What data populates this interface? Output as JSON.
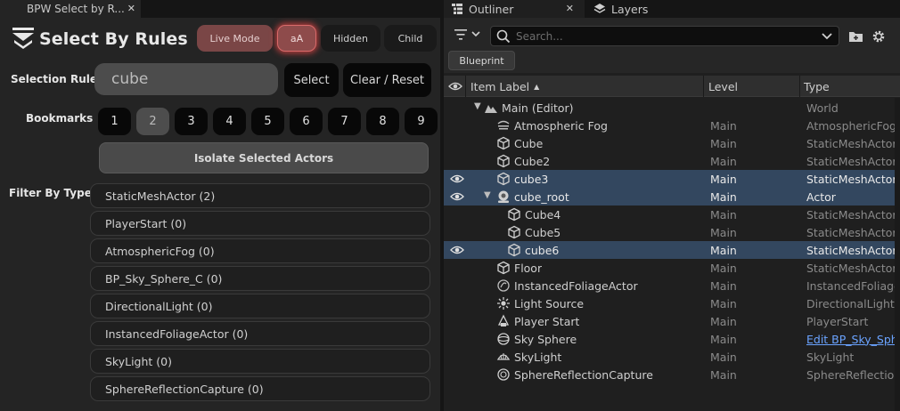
{
  "left_panel": {
    "tab_title": "BPW Select by R...",
    "title": "Select By Rules",
    "buttons": {
      "live_mode": "Live Mode",
      "match_case": "aA",
      "hidden": "Hidden",
      "child": "Child"
    },
    "selection_rule_label": "Selection Rule",
    "rule_input_value": "cube",
    "select_label": "Select",
    "clear_reset_label": "Clear / Reset",
    "bookmarks_label": "Bookmarks",
    "bookmarks": [
      "1",
      "2",
      "3",
      "4",
      "5",
      "6",
      "7",
      "8",
      "9"
    ],
    "selected_bookmark": "2",
    "isolate_label": "Isolate Selected Actors",
    "filter_label": "Filter By Types",
    "types": [
      "StaticMeshActor  (2)",
      "PlayerStart  (0)",
      "AtmosphericFog  (0)",
      "BP_Sky_Sphere_C  (0)",
      "DirectionalLight  (0)",
      "InstancedFoliageActor  (0)",
      "SkyLight  (0)",
      "SphereReflectionCapture  (0)"
    ]
  },
  "right_panel": {
    "tabs": [
      "Outliner",
      "Layers"
    ],
    "search_placeholder": "Search...",
    "blueprint_label": "Blueprint",
    "columns": [
      "Item Label",
      "Level",
      "Type"
    ],
    "rows": [
      {
        "label": "Main (Editor)",
        "level": "",
        "type": "World",
        "icon": "world-icon",
        "selected": false,
        "eye": false
      },
      {
        "label": "Atmospheric Fog",
        "level": "Main",
        "type": "AtmosphericFog",
        "icon": "fog-icon",
        "selected": false,
        "eye": false
      },
      {
        "label": "Cube",
        "level": "Main",
        "type": "StaticMeshActor",
        "icon": "mesh-icon",
        "selected": false,
        "eye": false
      },
      {
        "label": "Cube2",
        "level": "Main",
        "type": "StaticMeshActor",
        "icon": "mesh-icon",
        "selected": false,
        "eye": false
      },
      {
        "label": "cube3",
        "level": "Main",
        "type": "StaticMeshActor",
        "icon": "mesh-icon",
        "selected": true,
        "eye": true
      },
      {
        "label": "cube_root",
        "level": "Main",
        "type": "Actor",
        "icon": "actor-icon",
        "selected": true,
        "eye": true
      },
      {
        "label": "Cube4",
        "level": "Main",
        "type": "StaticMeshActor",
        "icon": "mesh-icon",
        "selected": false,
        "eye": false
      },
      {
        "label": "Cube5",
        "level": "Main",
        "type": "StaticMeshActor",
        "icon": "mesh-icon",
        "selected": false,
        "eye": false
      },
      {
        "label": "cube6",
        "level": "Main",
        "type": "StaticMeshActor",
        "icon": "mesh-icon",
        "selected": true,
        "eye": true
      },
      {
        "label": "Floor",
        "level": "Main",
        "type": "StaticMeshActor",
        "icon": "mesh-icon",
        "selected": false,
        "eye": false
      },
      {
        "label": "InstancedFoliageActor",
        "level": "Main",
        "type": "InstancedFoliage",
        "icon": "foliage-icon",
        "selected": false,
        "eye": false
      },
      {
        "label": "Light Source",
        "level": "Main",
        "type": "DirectionalLight",
        "icon": "light-icon",
        "selected": false,
        "eye": false
      },
      {
        "label": "Player Start",
        "level": "Main",
        "type": "PlayerStart",
        "icon": "player-start-icon",
        "selected": false,
        "eye": false
      },
      {
        "label": "Sky Sphere",
        "level": "Main",
        "type": "Edit BP_Sky_Sph",
        "icon": "sky-sphere-icon",
        "selected": false,
        "eye": false,
        "type_link": true
      },
      {
        "label": "SkyLight",
        "level": "Main",
        "type": "SkyLight",
        "icon": "skylight-icon",
        "selected": false,
        "eye": false
      },
      {
        "label": "SphereReflectionCapture",
        "level": "Main",
        "type": "SphereReflection",
        "icon": "reflection-icon",
        "selected": false,
        "eye": false
      }
    ]
  },
  "colors": {
    "selection": "#33475f",
    "live_mode": "#7a4646",
    "match_case_glow": "#e64646",
    "link": "#6aa3ff"
  }
}
